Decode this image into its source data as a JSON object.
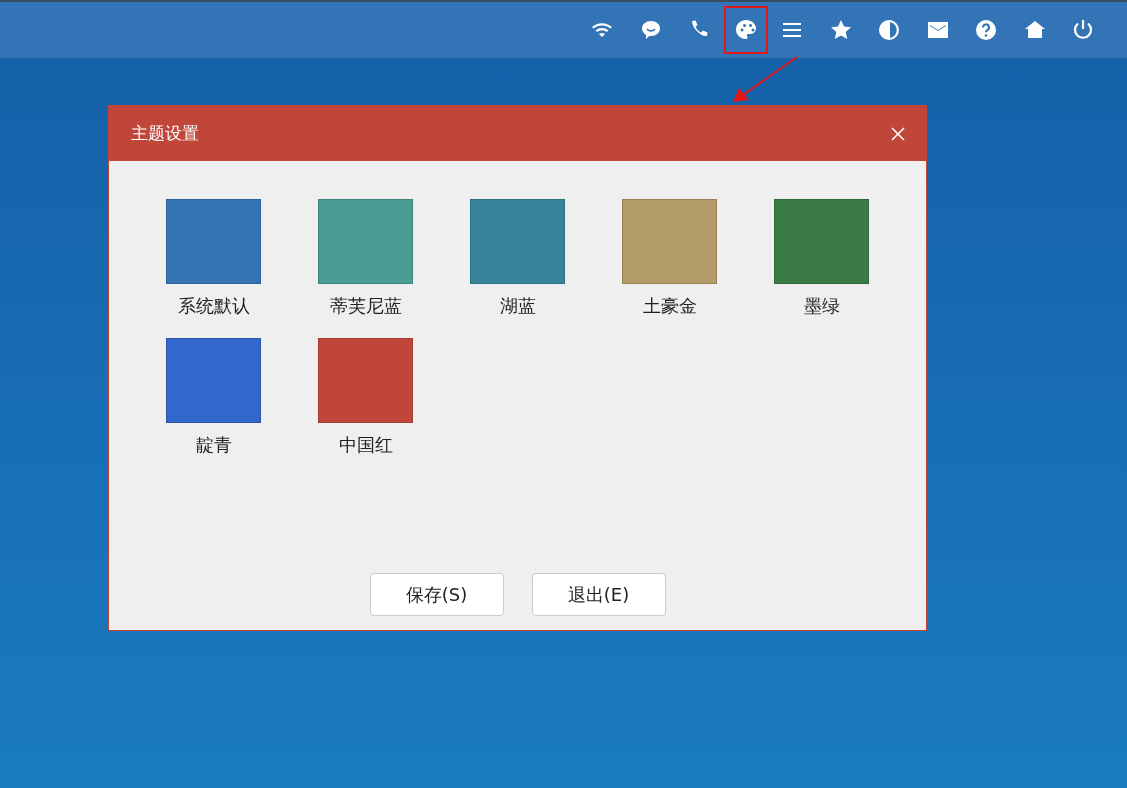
{
  "toolbar_icons": [
    {
      "kind": "wifi",
      "highlighted": false
    },
    {
      "kind": "chat",
      "highlighted": false
    },
    {
      "kind": "phone",
      "highlighted": false
    },
    {
      "kind": "palette",
      "highlighted": true
    },
    {
      "kind": "menu",
      "highlighted": false
    },
    {
      "kind": "star",
      "highlighted": false
    },
    {
      "kind": "contrast",
      "highlighted": false
    },
    {
      "kind": "mail",
      "highlighted": false
    },
    {
      "kind": "help",
      "highlighted": false
    },
    {
      "kind": "home",
      "highlighted": false
    },
    {
      "kind": "power",
      "highlighted": false
    }
  ],
  "dialog": {
    "title": "主题设置",
    "themes": [
      {
        "name": "系统默认",
        "color": "#3473b4"
      },
      {
        "name": "蒂芙尼蓝",
        "color": "#4a9d95"
      },
      {
        "name": "湖蓝",
        "color": "#39849a"
      },
      {
        "name": "土豪金",
        "color": "#b39a69"
      },
      {
        "name": "墨绿",
        "color": "#3a7b45"
      },
      {
        "name": "靛青",
        "color": "#3467cc"
      },
      {
        "name": "中国红",
        "color": "#c0463a"
      }
    ],
    "buttons": [
      "保存(S)",
      "退出(E)"
    ]
  }
}
